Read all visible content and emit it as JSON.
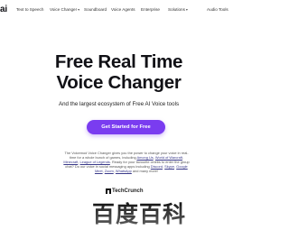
{
  "brand": {
    "logo_text": "ai"
  },
  "nav": {
    "items": [
      {
        "label": "Text to Speech",
        "has_dropdown": false
      },
      {
        "label": "Voice Changer",
        "has_dropdown": true
      },
      {
        "label": "Soundboard",
        "has_dropdown": false
      },
      {
        "label": "Voice Agents",
        "has_dropdown": false
      },
      {
        "label": "Enterprise",
        "has_dropdown": false
      },
      {
        "label": "Solutions",
        "has_dropdown": true
      },
      {
        "label": "Audio Tools",
        "has_dropdown": false
      }
    ]
  },
  "hero": {
    "title_line1": "Free Real Time",
    "title_line2": "Voice Changer",
    "subtitle": "And the largest ecosystem of Free AI Voice tools",
    "cta_label": "Get Started for Free"
  },
  "description": {
    "p1": "The Voicemod Voice Changer gives you the power to change your voice in real-time for a whole bunch of games, including ",
    "l1": "Among Us",
    "p2": ", ",
    "l2": "World of Warcraft",
    "p3": ", ",
    "l3": "Minecraft",
    "p4": ", ",
    "l4": "League of Legends",
    "p5": ". Ready for your favourite celebs to enter the group chat? Do our voice in social messaging apps including ",
    "l5": "Discord",
    "p6": ", ",
    "l6": "Skype",
    "p7": ", ",
    "l7": "Google Meet",
    "p8": ", ",
    "l8": "Zoom",
    "p9": ", ",
    "l9": "WhatsApp",
    "p10": " and many more!"
  },
  "press": {
    "logo_text": "TechCrunch"
  },
  "watermark": {
    "text": "百度百科"
  },
  "colors": {
    "accent": "#7a3cf0",
    "text": "#111116"
  }
}
